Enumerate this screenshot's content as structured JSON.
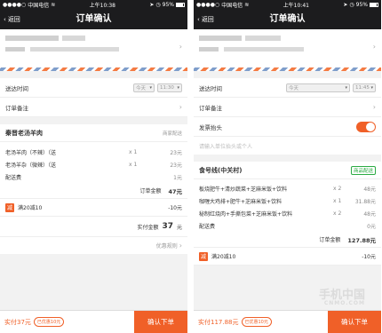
{
  "phone1": {
    "status": {
      "carrier": "中国电信",
      "time": "上午10:38",
      "battery": "95%"
    },
    "nav": {
      "back": "返回",
      "title": "订单确认"
    },
    "delivery_time": {
      "label": "送达时间",
      "day": "今天",
      "time": "11:30"
    },
    "note_label": "订单备注",
    "shop": {
      "name": "秦晋老汤羊肉",
      "tag": "商家配送"
    },
    "items": [
      {
        "name": "老汤羊肉（不辣）（送",
        "qty": "x 1",
        "price": "23元"
      },
      {
        "name": "老汤羊杂（微辣）（送",
        "qty": "x 1",
        "price": "23元"
      },
      {
        "name": "配送费",
        "qty": "",
        "price": "1元"
      }
    ],
    "order_total": {
      "label": "订单金额",
      "value": "47元"
    },
    "promo": {
      "mark": "减",
      "label": "满20减10",
      "value": "-10元"
    },
    "paid": {
      "label": "实付金额",
      "value": "37",
      "unit": "元"
    },
    "rules": "优惠规则",
    "bottom": {
      "paid": "实付37元",
      "discount": "已优惠10元",
      "cta": "确认下单"
    }
  },
  "phone2": {
    "status": {
      "carrier": "中国电信",
      "time": "上午10:41",
      "battery": "95%"
    },
    "nav": {
      "back": "返回",
      "title": "订单确认"
    },
    "delivery_time": {
      "label": "送达时间",
      "day": "今天",
      "time": "11:45"
    },
    "note_label": "订单备注",
    "invoice": {
      "label": "发票抬头",
      "placeholder": "请输入单位抬头或个人"
    },
    "shop": {
      "name": "食号线(中关村)",
      "tag": "商品配送"
    },
    "items": [
      {
        "name": "板烧肥牛+清炒蔬菜+芝麻米饭+饮料",
        "qty": "x 2",
        "price": "48元"
      },
      {
        "name": "咖喱大鸡排+肥牛+芝麻米饭+饮料",
        "qty": "x 1",
        "price": "31.88元"
      },
      {
        "name": "秘制红烧肉+手撕包菜+芝麻米饭+饮料",
        "qty": "x 2",
        "price": "48元"
      },
      {
        "name": "配送费",
        "qty": "",
        "price": "0元"
      }
    ],
    "order_total": {
      "label": "订单金额",
      "value": "127.88元"
    },
    "promo": {
      "mark": "减",
      "label": "满20减10",
      "value": "-10元"
    },
    "bottom": {
      "paid": "实付117.88元",
      "discount": "已优惠10元",
      "cta": "确认下单"
    }
  },
  "watermark": {
    "line1": "手机中国",
    "line2": "CNMO.COM"
  },
  "colors": {
    "accent": "#f06028",
    "bar": "#1c1c1e",
    "green": "#2bab43"
  }
}
